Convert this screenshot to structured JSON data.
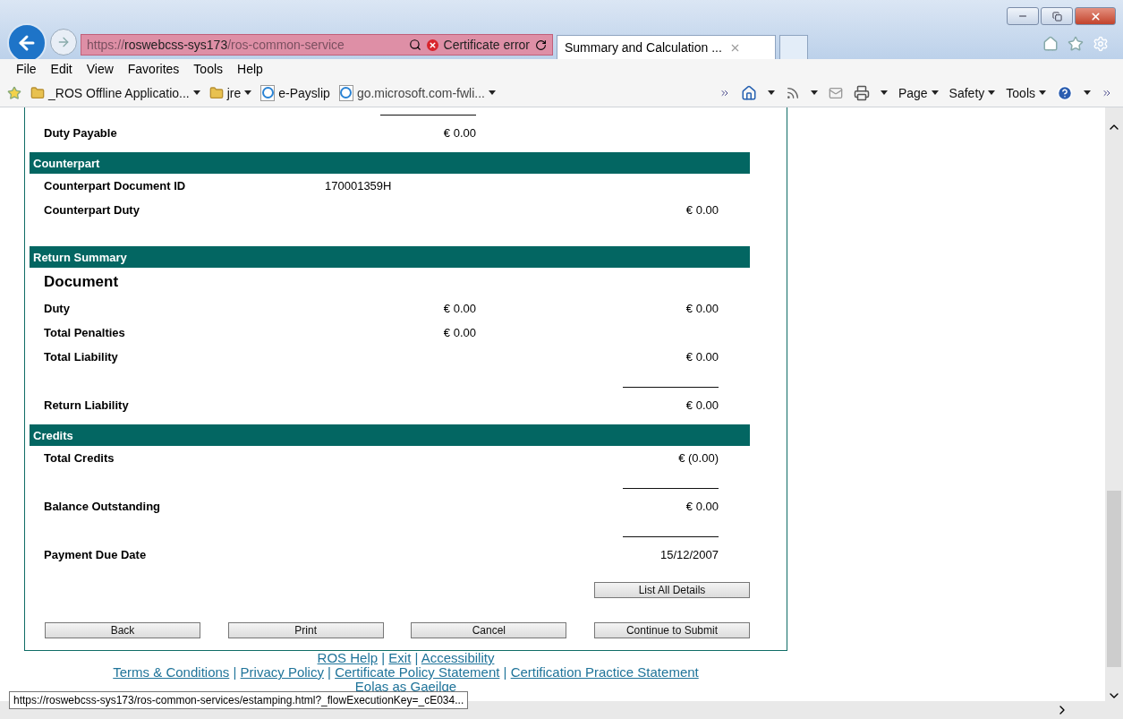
{
  "browser": {
    "address": {
      "scheme": "https://",
      "host": "roswebcss-sys173",
      "path": "/ros-common-service"
    },
    "certificate": "Certificate error",
    "tabs": [
      {
        "title": "Summary and Calculation ...",
        "selected": true
      }
    ],
    "menu": [
      "File",
      "Edit",
      "View",
      "Favorites",
      "Tools",
      "Help"
    ],
    "favorites": [
      {
        "kind": "folder",
        "label": "_ROS Offline Applicatio...",
        "dropdown": true
      },
      {
        "kind": "folder",
        "label": "jre",
        "dropdown": true
      },
      {
        "kind": "page",
        "label": "e-Payslip",
        "dropdown": false
      },
      {
        "kind": "page",
        "label": "go.microsoft.com-fwli...",
        "dropdown": true
      }
    ],
    "commands": [
      "Page",
      "Safety",
      "Tools"
    ]
  },
  "form": {
    "blocks": [
      {
        "kind": "row",
        "label": "Duty Payable",
        "middle": "€ 0.00",
        "ruled": true
      },
      {
        "kind": "section",
        "title": "Counterpart"
      },
      {
        "kind": "row",
        "label": "Counterpart Document ID",
        "reference": "170001359H"
      },
      {
        "kind": "row",
        "label": "Counterpart Duty",
        "right": "€ 0.00"
      },
      {
        "kind": "spacer"
      },
      {
        "kind": "section",
        "title": "Return Summary"
      },
      {
        "kind": "heading",
        "text": "Document"
      },
      {
        "kind": "row",
        "label": "Duty",
        "middle": "€ 0.00",
        "right": "€ 0.00"
      },
      {
        "kind": "row",
        "label": "Total Penalties",
        "middle": "€ 0.00"
      },
      {
        "kind": "row",
        "label": "Total Liability",
        "right": "€ 0.00"
      },
      {
        "kind": "row",
        "label": "Return Liability",
        "right": "€ 0.00",
        "ruled": true
      },
      {
        "kind": "section",
        "title": "Credits"
      },
      {
        "kind": "row",
        "label": "Total Credits",
        "right": "€ (0.00)"
      },
      {
        "kind": "row",
        "label": "Balance Outstanding",
        "right": "€ 0.00",
        "ruled": true
      },
      {
        "kind": "row",
        "label": "Payment Due Date",
        "right": "15/12/2007",
        "ruled": true
      }
    ],
    "details_button": "List All Details",
    "buttons": [
      "Back",
      "Print",
      "Cancel",
      "Continue to Submit"
    ]
  },
  "footer": {
    "separator": "|",
    "lines": [
      [
        "ROS Help",
        "Exit",
        "Accessibility"
      ],
      [
        "Terms & Conditions",
        "Privacy Policy",
        "Certificate Policy Statement",
        "Certification Practice Statement"
      ],
      [
        "Eolas as Gaeilge"
      ]
    ]
  },
  "status_url": "https://roswebcss-sys173/ros-common-services/estamping.html?_flowExecutionKey=_cE034..."
}
